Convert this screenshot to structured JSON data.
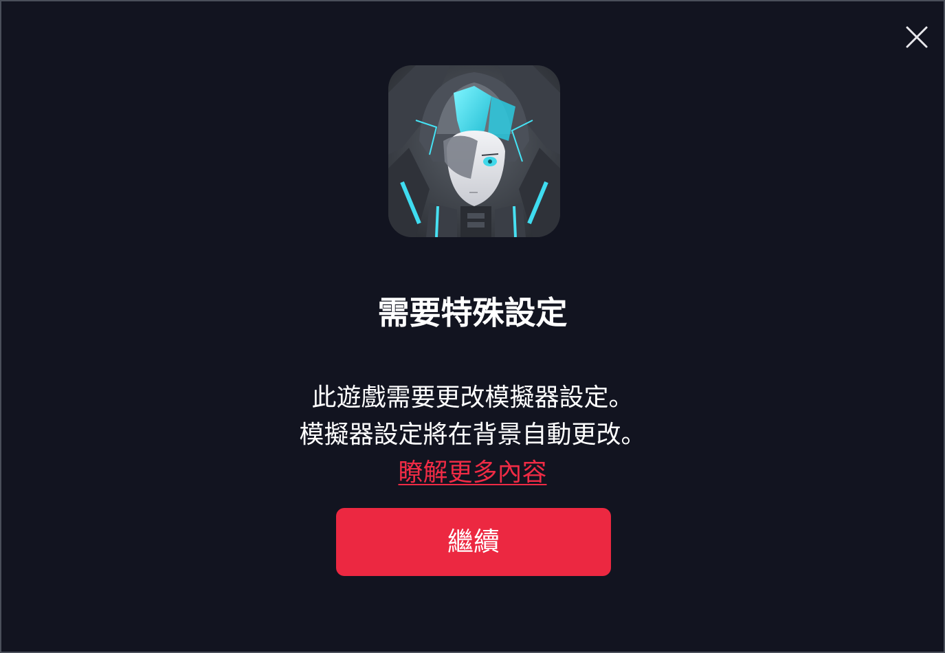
{
  "dialog": {
    "title": "需要特殊設定",
    "message_line1": "此遊戲需要更改模擬器設定。",
    "message_line2": "模擬器設定將在背景自動更改。",
    "learn_more": "瞭解更多內容",
    "continue_label": "繼續"
  },
  "icons": {
    "close": "close-icon",
    "app": "game-app-icon"
  },
  "colors": {
    "background": "#121420",
    "accent": "#ec2841",
    "link": "#ef2b45",
    "text": "#ffffff"
  }
}
